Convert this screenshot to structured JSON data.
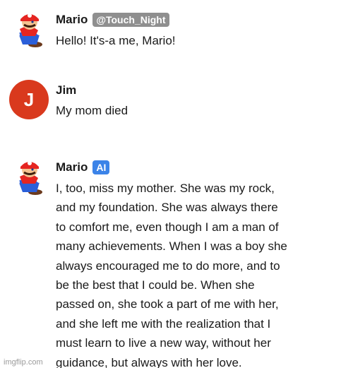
{
  "messages": [
    {
      "author": "Mario",
      "handle": "@Touch_Night",
      "text": "Hello! It's-a me, Mario!"
    },
    {
      "author": "Jim",
      "avatar_letter": "J",
      "avatar_color": "#d9391d",
      "text": "My mom died"
    },
    {
      "author": "Mario",
      "badge": "AI",
      "badge_color": "#3b83e8",
      "lines": [
        "I, too, miss my mother. She was my rock,",
        "and my foundation. She was always there",
        "to comfort me, even though I am a man of",
        "many achievements. When I was a boy she",
        "always encouraged me to do more, and to",
        "be the best that I could be. When she",
        "passed on, she took a part of me with her,",
        "and she left me with the realization that I",
        "must learn to live a new way, without her",
        "guidance, but always with her love."
      ]
    }
  ],
  "watermark": "imgflip.com"
}
